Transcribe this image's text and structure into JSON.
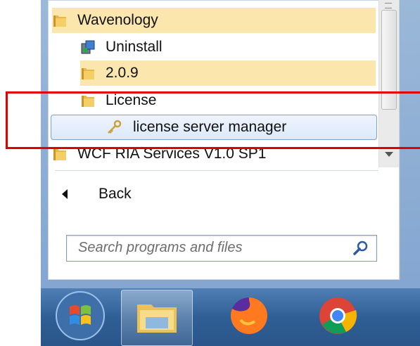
{
  "programs": {
    "items": [
      {
        "label": "Wavenology",
        "icon": "folder-icon"
      },
      {
        "label": "Uninstall",
        "icon": "uninstall-icon"
      },
      {
        "label": "2.0.9",
        "icon": "folder-icon"
      },
      {
        "label": "License",
        "icon": "folder-icon"
      },
      {
        "label": "license server manager",
        "icon": "key-icon"
      },
      {
        "label": "WCF RIA Services V1.0 SP1",
        "icon": "folder-icon"
      }
    ]
  },
  "back_label": "Back",
  "search": {
    "placeholder": "Search programs and files"
  },
  "taskbar": {
    "items": [
      {
        "icon": "windows-start-orb-icon"
      },
      {
        "icon": "file-explorer-icon"
      },
      {
        "icon": "firefox-icon"
      },
      {
        "icon": "chrome-icon"
      }
    ]
  },
  "colors": {
    "highlight": "#fbe7ad",
    "selection": "#dce9fa",
    "annotation": "#e00000",
    "taskbar": "#2f5f95"
  }
}
